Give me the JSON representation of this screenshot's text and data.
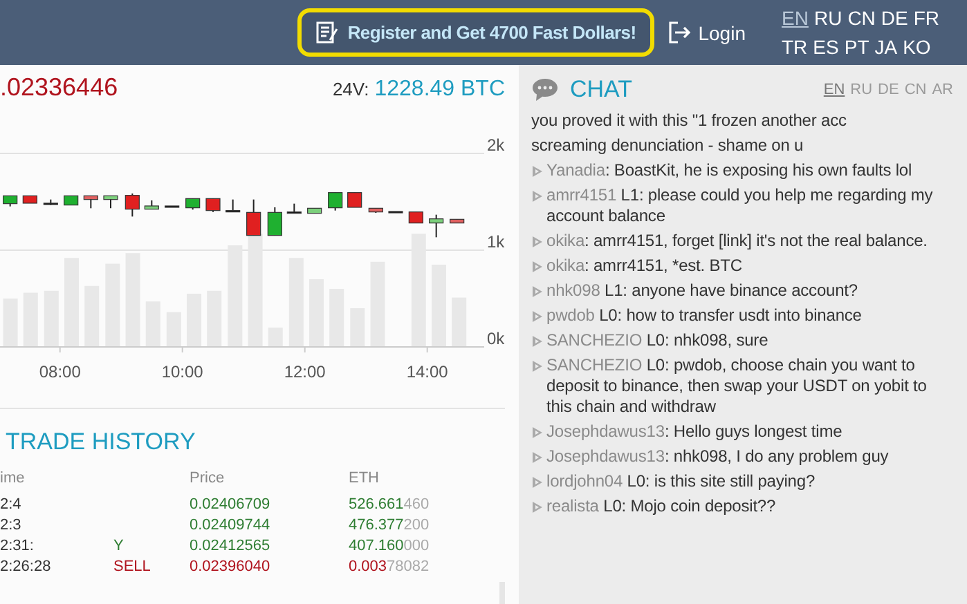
{
  "header": {
    "promo_button": "Register and Get 4700 Fast Dollars!",
    "login": "Login",
    "languages": [
      {
        "label": "EN",
        "selected": true
      },
      {
        "label": "RU",
        "selected": false
      },
      {
        "label": "CN",
        "selected": false
      },
      {
        "label": "DE",
        "selected": false
      },
      {
        "label": "FR",
        "selected": false
      },
      {
        "label": "TR",
        "selected": false
      },
      {
        "label": "ES",
        "selected": false
      },
      {
        "label": "PT",
        "selected": false
      },
      {
        "label": "JA",
        "selected": false
      },
      {
        "label": "KO",
        "selected": false
      }
    ]
  },
  "ticker": {
    "last_price": ".02336446",
    "volume_label": "24V:",
    "volume": "1228.49 BTC"
  },
  "chart": {
    "chart_data": {
      "type": "bar",
      "x": [
        7.19,
        7.52,
        7.86,
        8.19,
        8.52,
        8.86,
        9.19,
        9.52,
        9.86,
        10.19,
        10.52,
        10.86,
        11.19,
        11.52,
        11.86,
        12.19,
        12.52,
        12.86,
        13.19,
        13.52,
        13.86,
        14.19,
        14.52
      ],
      "values": [
        500,
        560,
        580,
        920,
        630,
        860,
        970,
        470,
        360,
        550,
        580,
        1050,
        1170,
        200,
        920,
        700,
        600,
        400,
        880,
        0,
        1170,
        850,
        510
      ],
      "xlim": [
        7.02,
        14.93
      ],
      "ylim": [
        0,
        2000
      ],
      "xticks": [
        {
          "value": 8,
          "label": "08:00"
        },
        {
          "value": 10,
          "label": "10:00"
        },
        {
          "value": 12,
          "label": "12:00"
        },
        {
          "value": 14,
          "label": "14:00"
        }
      ],
      "yticks": [
        {
          "value": 0,
          "label": "0k"
        },
        {
          "value": 1000,
          "label": "1k"
        },
        {
          "value": 2000,
          "label": "2k"
        }
      ]
    }
  },
  "trade_history": {
    "title": "TRADE HISTORY",
    "columns": {
      "time": "ime",
      "price": "Price",
      "eth": "ETH"
    },
    "rows": [
      {
        "time": "2:4",
        "color": "#2e7d32",
        "price": "0.02406709",
        "eth": "526.661",
        "eth_trailing": "460"
      },
      {
        "time": "2:3",
        "color": "#2e7d32",
        "price": "0.02409744",
        "eth": "476.377",
        "eth_trailing": "200"
      },
      {
        "time": "2:31:",
        "color": "#2e7d32",
        "type": "Y",
        "price": "0.02412565",
        "eth": "407.160",
        "eth_trailing": "000"
      },
      {
        "time": "2:26:28",
        "color": "#b0141e",
        "type": "SELL",
        "price": "0.02396040",
        "eth": "0.003",
        "eth_trailing": "78082"
      }
    ]
  },
  "chat": {
    "title": "CHAT",
    "languages": [
      {
        "label": "EN",
        "selected": true
      },
      {
        "label": "RU",
        "selected": false
      },
      {
        "label": "DE",
        "selected": false
      },
      {
        "label": "CN",
        "selected": false
      },
      {
        "label": "AR",
        "selected": false
      }
    ],
    "messages": [
      {
        "kind": "continuation",
        "text": "you proved it with this \"1 frozen another acc"
      },
      {
        "kind": "continuation",
        "text": "screaming denunciation - shame on u"
      },
      {
        "kind": "message",
        "user": "Yanadia",
        "tag": ":",
        "text": "BoastKit, he is exposing his own faults lol"
      },
      {
        "kind": "message",
        "user": "amrr4151",
        "tag": "L1:",
        "text": "please could you help me regarding my account balance"
      },
      {
        "kind": "message",
        "user": "okika",
        "tag": ":",
        "text": "amrr4151, forget [link] it's not the real balance."
      },
      {
        "kind": "message",
        "user": "okika",
        "tag": ":",
        "text": "amrr4151, *est. BTC"
      },
      {
        "kind": "message",
        "user": "nhk098",
        "tag": "L1:",
        "text": "anyone have binance account?"
      },
      {
        "kind": "message",
        "user": "pwdob",
        "tag": "L0:",
        "text": "how to transfer usdt into binance"
      },
      {
        "kind": "message",
        "user": "SANCHEZIO",
        "tag": "L0:",
        "text": "nhk098, sure"
      },
      {
        "kind": "message",
        "user": "SANCHEZIO",
        "tag": "L0:",
        "text": "pwdob, choose chain you want to deposit to binance, then swap your USDT on yobit to this chain and withdraw"
      },
      {
        "kind": "message",
        "user": "Josephdawus13",
        "tag": ":",
        "text": "Hello guys longest time"
      },
      {
        "kind": "message",
        "user": "Josephdawus13",
        "tag": ":",
        "text": "nhk098, I do any problem guy"
      },
      {
        "kind": "message",
        "user": "lordjohn04",
        "tag": "L0:",
        "text": "is this site still paying?"
      },
      {
        "kind": "message",
        "user": "realista",
        "tag": "L0:",
        "text": "Mojo coin deposit??"
      }
    ]
  }
}
